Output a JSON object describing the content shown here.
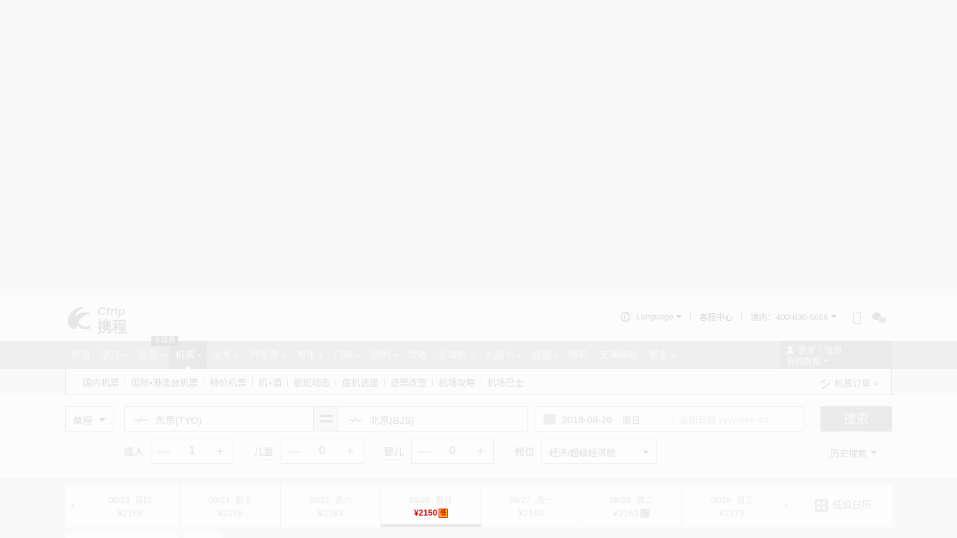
{
  "logo": {
    "text_en": "Ctrip",
    "text_cn": "携程"
  },
  "utility": {
    "language": "Language",
    "service_center": "客服中心",
    "hotline": "境内：400-830-6666"
  },
  "nav": {
    "items": [
      {
        "label": "首页",
        "caret": false
      },
      {
        "label": "酒店",
        "caret": true
      },
      {
        "label": "旅游",
        "caret": true
      },
      {
        "label": "机票",
        "caret": true
      },
      {
        "label": "火车",
        "caret": true
      },
      {
        "label": "汽车票",
        "caret": true
      },
      {
        "label": "用车",
        "caret": true
      },
      {
        "label": "门票",
        "caret": true
      },
      {
        "label": "团购",
        "caret": true
      },
      {
        "label": "攻略",
        "caret": false
      },
      {
        "label": "全球购",
        "caret": true
      },
      {
        "label": "礼品卡",
        "caret": true
      },
      {
        "label": "商旅",
        "caret": true
      },
      {
        "label": "邮轮",
        "caret": false
      },
      {
        "label": "天海邮轮",
        "caret": false
      },
      {
        "label": "更多",
        "caret": true
      }
    ],
    "active_index": 3,
    "badge": "全球游",
    "login": "登录",
    "register": "注册",
    "my_trips": "我的携程"
  },
  "subnav": {
    "items": [
      "国内机票",
      "国际•港澳台机票",
      "特价机票",
      "机+酒",
      "航班动态",
      "值机选座",
      "退票改签",
      "机场攻略",
      "机场巴士"
    ],
    "order_link": "机票订单 >"
  },
  "search": {
    "trip_type": "单程",
    "from_city": "东京(TYO)",
    "to_city": "北京(BJS)",
    "depart_date": "2018-08-26",
    "depart_week": "周日",
    "return_placeholder": "返回日期 yyyy-mm-dd",
    "search_button": "搜索",
    "adults_label": "成人",
    "adults": "1",
    "children_label": "儿童",
    "children": "0",
    "infants_label": "婴儿",
    "infants": "0",
    "cabin_label": "舱位",
    "cabin_value": "经济/超级经济舱",
    "history": "历史搜索",
    "minus": "—",
    "plus": "+"
  },
  "date_strip": {
    "prev": "‹",
    "next": "›",
    "dates": [
      {
        "date": "08/23",
        "week": "周四",
        "price": "¥2166"
      },
      {
        "date": "08/24",
        "week": "周五",
        "price": "¥2166"
      },
      {
        "date": "08/25",
        "week": "周六",
        "price": "¥2183"
      },
      {
        "date": "08/26",
        "week": "周日",
        "price": "¥2150",
        "tag": "低"
      },
      {
        "date": "08/27",
        "week": "周一",
        "price": "¥2180"
      },
      {
        "date": "08/28",
        "week": "周二",
        "price": "¥2163",
        "tag": "低"
      },
      {
        "date": "08/29",
        "week": "周三",
        "price": "¥2178"
      }
    ],
    "selected_index": 3,
    "low_calendar": "低价日历"
  }
}
